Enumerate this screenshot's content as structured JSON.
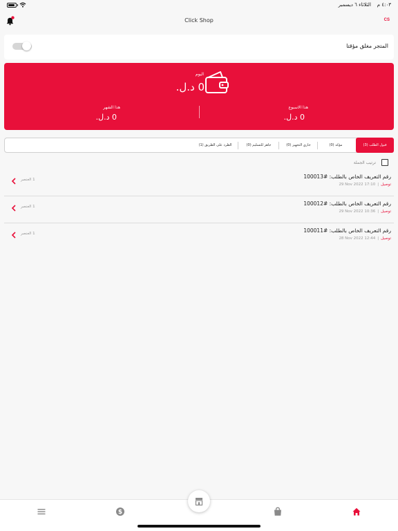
{
  "status_bar": {
    "time_text": "٤:٠٣ م",
    "date_text": "الثلاثاء ٦ ديسمبر"
  },
  "header": {
    "title": "Click Shop",
    "logo_text": "CS",
    "notification_dot": true
  },
  "store": {
    "closed_label": "المتجر مغلق مؤقتا",
    "closed_toggle_on": false
  },
  "stats": {
    "today_label": "اليوم",
    "today_value": "0 د.ل.",
    "week_label": "هذا الاسبوع",
    "week_value": "0 د.ل.",
    "month_label": "هذا الشهر",
    "month_value": "0 د.ل."
  },
  "tabs": [
    {
      "label": "قبول الطلب (3)",
      "active": true
    },
    {
      "label": "مؤكد (0)",
      "active": false
    },
    {
      "label": "جاري التجهيز (0)",
      "active": false
    },
    {
      "label": "جاهز للتسليم (0)",
      "active": false
    },
    {
      "label": "الطرد على الطريق (1)",
      "active": false
    }
  ],
  "select_all_label": "ترتيب الجملة",
  "orders": [
    {
      "id_text": "رقم التعريف الخاص بالطلب: #100013",
      "date": "29 Nov 2022  17:10",
      "kind": "توصيل",
      "count": "1 العنصر"
    },
    {
      "id_text": "رقم التعريف الخاص بالطلب: #100012",
      "date": "29 Nov 2022  10:36",
      "kind": "توصيل",
      "count": "1 العنصر"
    },
    {
      "id_text": "رقم التعريف الخاص بالطلب: #100011",
      "date": "28 Nov 2022  12:44",
      "kind": "توصيل",
      "count": "1 العنصر"
    }
  ],
  "bottom_nav": [
    {
      "icon": "home-icon",
      "active": true
    },
    {
      "icon": "shopping-bag-icon",
      "active": false
    },
    {
      "icon": "dollar-icon",
      "active": false
    },
    {
      "icon": "menu-icon",
      "active": false
    }
  ],
  "fab_icon": "store-icon",
  "colors": {
    "accent": "#e8103a",
    "inactive_icon": "#8a8a8a"
  }
}
